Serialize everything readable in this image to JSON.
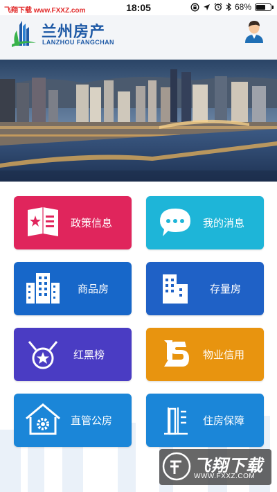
{
  "status_bar": {
    "watermark": "飞翔下载 www.FXXZ.com",
    "time": "18:05",
    "battery_text": "68%",
    "battery_level": 0.68,
    "icons": [
      "lock-rotation-icon",
      "location-arrow-icon",
      "alarm-icon",
      "bluetooth-icon",
      "battery-icon"
    ]
  },
  "header": {
    "title_cn": "兰州房产",
    "title_en": "LANZHOU FANGCHAN",
    "avatar_icon": "user-avatar-icon"
  },
  "banner": {
    "image": "city-night-riverside-photo"
  },
  "menu": [
    {
      "label": "政策信息",
      "icon": "policy-book-icon",
      "color": "#e0255c"
    },
    {
      "label": "我的消息",
      "icon": "chat-bubble-icon",
      "color": "#1eb5d8"
    },
    {
      "label": "商品房",
      "icon": "building-icon",
      "color": "#1767c9"
    },
    {
      "label": "存量房",
      "icon": "tower-icon",
      "color": "#1f61c6"
    },
    {
      "label": "红黑榜",
      "icon": "medal-star-icon",
      "color": "#4a3cc3"
    },
    {
      "label": "物业信用",
      "icon": "ls-logo-icon",
      "color": "#e8940f"
    },
    {
      "label": "直管公房",
      "icon": "house-gear-icon",
      "color": "#1b86d8"
    },
    {
      "label": "住房保障",
      "icon": "shield-building-icon",
      "color": "#1b86d8"
    }
  ],
  "watermark": {
    "title": "飞翔下载",
    "url": "WWW.FXXZ.COM"
  }
}
